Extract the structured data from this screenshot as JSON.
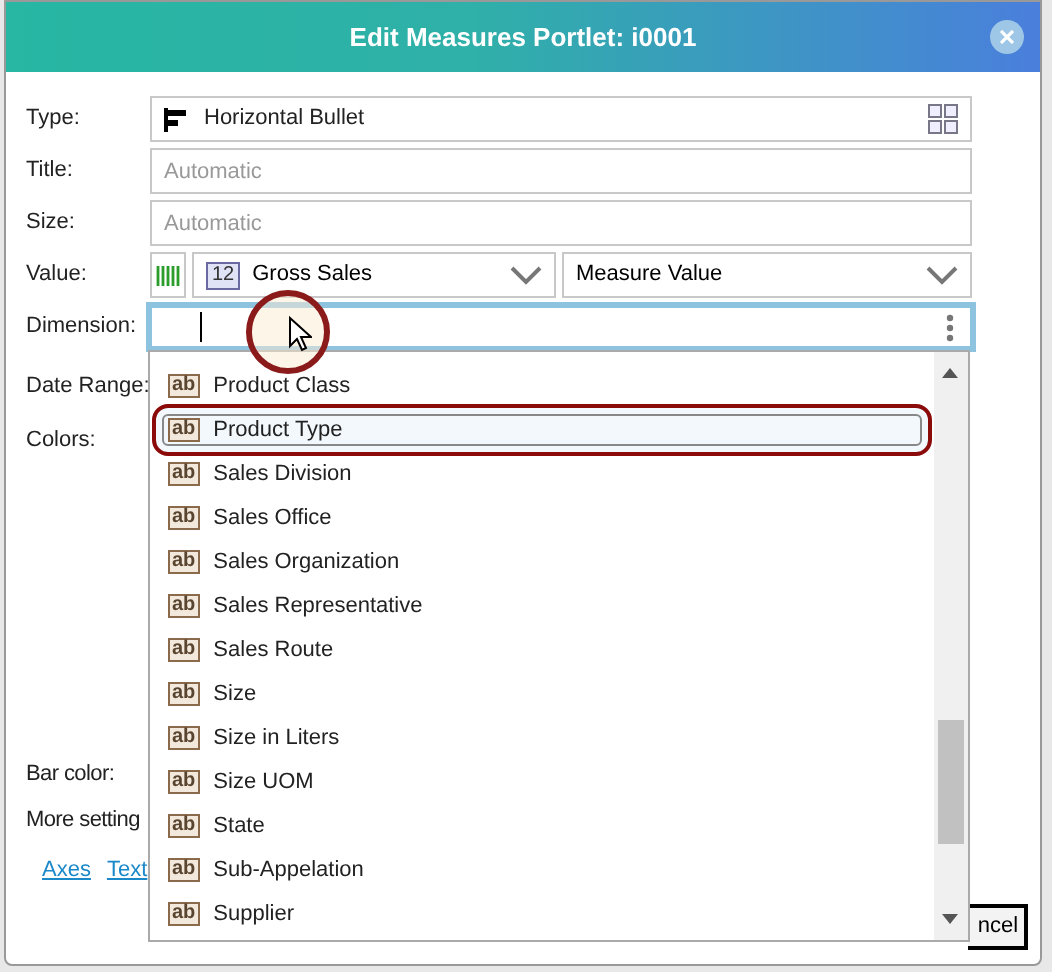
{
  "window": {
    "title": "Edit Measures Portlet: i0001"
  },
  "fields": [
    {
      "label": "Type:",
      "kind": "type",
      "value": "Horizontal Bullet"
    },
    {
      "label": "Title:",
      "kind": "text",
      "placeholder": "Automatic"
    },
    {
      "label": "Size:",
      "kind": "text",
      "placeholder": "Automatic"
    },
    {
      "label": "Value:",
      "kind": "value",
      "badge": "12",
      "measure": "Gross Sales",
      "aggregation": "Measure Value"
    },
    {
      "label": "Dimension:",
      "kind": "search"
    }
  ],
  "hidden_labels": [
    "Date Range:",
    "Colors:"
  ],
  "lower_labels": [
    "Bar color:",
    "More setting"
  ],
  "links": [
    "Axes",
    "Text"
  ],
  "cancel_button": "ncel",
  "dropdown": {
    "items": [
      {
        "badge": "ab",
        "label": "Product Class",
        "selected": false
      },
      {
        "badge": "ab",
        "label": "Product Type",
        "selected": true
      },
      {
        "badge": "ab",
        "label": "Sales Division",
        "selected": false
      },
      {
        "badge": "ab",
        "label": "Sales Office",
        "selected": false
      },
      {
        "badge": "ab",
        "label": "Sales Organization",
        "selected": false
      },
      {
        "badge": "ab",
        "label": "Sales Representative",
        "selected": false
      },
      {
        "badge": "ab",
        "label": "Sales Route",
        "selected": false
      },
      {
        "badge": "ab",
        "label": "Size",
        "selected": false
      },
      {
        "badge": "ab",
        "label": "Size in Liters",
        "selected": false
      },
      {
        "badge": "ab",
        "label": "Size UOM",
        "selected": false
      },
      {
        "badge": "ab",
        "label": "State",
        "selected": false
      },
      {
        "badge": "ab",
        "label": "Sub-Appelation",
        "selected": false
      },
      {
        "badge": "ab",
        "label": "Supplier",
        "selected": false
      }
    ]
  }
}
